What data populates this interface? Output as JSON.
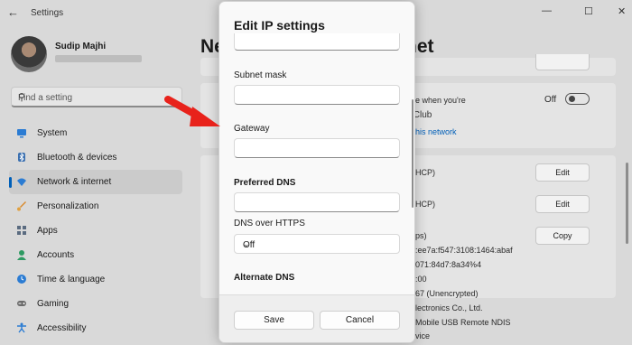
{
  "titlebar": {
    "title": "Settings",
    "back_glyph": "←",
    "minimize_glyph": "—",
    "maximize_glyph": "☐",
    "close_glyph": "✕"
  },
  "profile": {
    "name": "Sudip Majhi"
  },
  "search": {
    "placeholder": "Find a setting"
  },
  "nav": {
    "items": [
      {
        "label": "System",
        "icon": "display-icon"
      },
      {
        "label": "Bluetooth & devices",
        "icon": "bluetooth-icon"
      },
      {
        "label": "Network & internet",
        "icon": "wifi-icon",
        "active": true
      },
      {
        "label": "Personalization",
        "icon": "brush-icon"
      },
      {
        "label": "Apps",
        "icon": "apps-icon"
      },
      {
        "label": "Accounts",
        "icon": "person-icon"
      },
      {
        "label": "Time & language",
        "icon": "globe-clock-icon"
      },
      {
        "label": "Gaming",
        "icon": "gamepad-icon"
      },
      {
        "label": "Accessibility",
        "icon": "accessibility-icon"
      }
    ]
  },
  "page": {
    "title_left": "Ne",
    "title_right": "rnet"
  },
  "right_panel": {
    "metered_text": "e when you're",
    "toggle_state": "Off",
    "link_text": "his network",
    "rows": [
      {
        "text": "HCP)",
        "button": "Edit"
      },
      {
        "text": "HCP)",
        "button": "Edit"
      }
    ],
    "copy_button": "Copy",
    "info_lines": [
      "ps)",
      ":ee7a:f547:3108:1464:abaf",
      "071:84d7:8a34%4",
      ":00",
      "67 (Unencrypted)",
      "lectronics Co., Ltd.",
      "Mobile USB Remote NDIS",
      "vice"
    ]
  },
  "watermark": {
    "text": "TheWindowsClub"
  },
  "dialog": {
    "title": "Edit IP settings",
    "fields": {
      "subnet_mask_label": "Subnet mask",
      "gateway_label": "Gateway",
      "preferred_dns_label": "Preferred DNS",
      "dns_over_https_label": "DNS over HTTPS",
      "dns_over_https_value": "Off",
      "alternate_dns_label": "Alternate DNS"
    },
    "save_label": "Save",
    "cancel_label": "Cancel"
  },
  "colors": {
    "accent": "#005fb8",
    "arrow": "#e8221b"
  }
}
